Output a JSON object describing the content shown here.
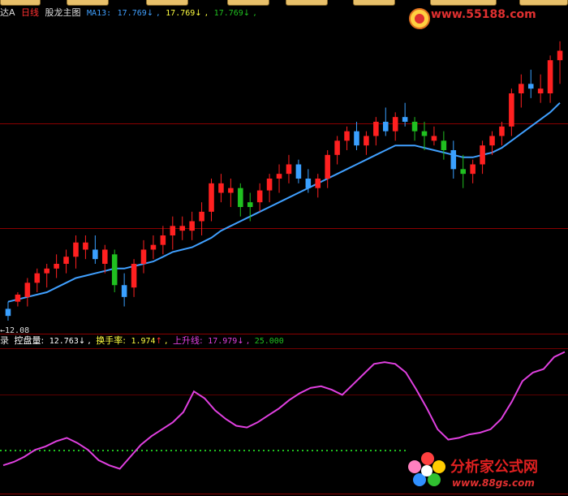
{
  "main_header": {
    "stock_suffix": "达A",
    "period": "日线",
    "indicator_name": "股龙主图",
    "ma_label": "MA13:",
    "ma_value": "17.769",
    "ma_arrow": "↓",
    "val2": "17.769",
    "val2_arrow": "↓",
    "val3": "17.769",
    "val3_arrow": "↓"
  },
  "logo": {
    "site": "www.55188.com"
  },
  "axis": {
    "date_marker": "←12.08"
  },
  "sub_header": {
    "prefix": "录",
    "kp_label": "控盘量:",
    "kp_value": "12.763",
    "kp_arrow": "↓",
    "hs_label": "换手率:",
    "hs_value": "1.974",
    "hs_arrow": "↑",
    "up_label": "上升线:",
    "up_value": "17.979",
    "up_arrow": "↓",
    "level": "25.000"
  },
  "watermark": {
    "title": "分析家公式网",
    "url": "www.88gs.com"
  },
  "colors": {
    "up": "#ff2020",
    "down": "#3aa0ff",
    "green": "#20c020",
    "ma_line": "#40a0ff",
    "ma_hi": "#ffff40",
    "indicator": "#e040e0",
    "dotted": "#20c020"
  },
  "chart_data": {
    "type": "candlestick+line",
    "candles": [
      {
        "o": 5,
        "h": 8,
        "l": 0,
        "c": 2,
        "col": "blue"
      },
      {
        "o": 8,
        "h": 12,
        "l": 6,
        "c": 11,
        "col": "red"
      },
      {
        "o": 10,
        "h": 18,
        "l": 6,
        "c": 16,
        "col": "red"
      },
      {
        "o": 16,
        "h": 22,
        "l": 12,
        "c": 20,
        "col": "red"
      },
      {
        "o": 20,
        "h": 24,
        "l": 14,
        "c": 22,
        "col": "red"
      },
      {
        "o": 22,
        "h": 28,
        "l": 18,
        "c": 24,
        "col": "red"
      },
      {
        "o": 24,
        "h": 30,
        "l": 20,
        "c": 27,
        "col": "red"
      },
      {
        "o": 27,
        "h": 36,
        "l": 22,
        "c": 33,
        "col": "red"
      },
      {
        "o": 33,
        "h": 36,
        "l": 26,
        "c": 30,
        "col": "red"
      },
      {
        "o": 30,
        "h": 36,
        "l": 24,
        "c": 26,
        "col": "blue"
      },
      {
        "o": 24,
        "h": 32,
        "l": 20,
        "c": 30,
        "col": "red"
      },
      {
        "o": 28,
        "h": 30,
        "l": 12,
        "c": 15,
        "col": "green"
      },
      {
        "o": 15,
        "h": 20,
        "l": 6,
        "c": 10,
        "col": "blue"
      },
      {
        "o": 14,
        "h": 26,
        "l": 10,
        "c": 24,
        "col": "red"
      },
      {
        "o": 24,
        "h": 34,
        "l": 20,
        "c": 30,
        "col": "red"
      },
      {
        "o": 30,
        "h": 36,
        "l": 26,
        "c": 32,
        "col": "red"
      },
      {
        "o": 32,
        "h": 40,
        "l": 28,
        "c": 36,
        "col": "red"
      },
      {
        "o": 36,
        "h": 44,
        "l": 30,
        "c": 40,
        "col": "red"
      },
      {
        "o": 40,
        "h": 44,
        "l": 34,
        "c": 38,
        "col": "red"
      },
      {
        "o": 38,
        "h": 46,
        "l": 34,
        "c": 42,
        "col": "red"
      },
      {
        "o": 42,
        "h": 50,
        "l": 36,
        "c": 46,
        "col": "red"
      },
      {
        "o": 46,
        "h": 60,
        "l": 42,
        "c": 58,
        "col": "red"
      },
      {
        "o": 58,
        "h": 62,
        "l": 50,
        "c": 54,
        "col": "red"
      },
      {
        "o": 54,
        "h": 60,
        "l": 48,
        "c": 56,
        "col": "red"
      },
      {
        "o": 56,
        "h": 58,
        "l": 44,
        "c": 48,
        "col": "green"
      },
      {
        "o": 48,
        "h": 54,
        "l": 42,
        "c": 50,
        "col": "green"
      },
      {
        "o": 50,
        "h": 58,
        "l": 46,
        "c": 55,
        "col": "red"
      },
      {
        "o": 55,
        "h": 62,
        "l": 50,
        "c": 60,
        "col": "red"
      },
      {
        "o": 60,
        "h": 66,
        "l": 54,
        "c": 62,
        "col": "red"
      },
      {
        "o": 62,
        "h": 70,
        "l": 58,
        "c": 66,
        "col": "red"
      },
      {
        "o": 66,
        "h": 68,
        "l": 58,
        "c": 60,
        "col": "blue"
      },
      {
        "o": 60,
        "h": 64,
        "l": 54,
        "c": 56,
        "col": "blue"
      },
      {
        "o": 56,
        "h": 62,
        "l": 52,
        "c": 60,
        "col": "red"
      },
      {
        "o": 60,
        "h": 72,
        "l": 56,
        "c": 70,
        "col": "red"
      },
      {
        "o": 70,
        "h": 78,
        "l": 66,
        "c": 76,
        "col": "red"
      },
      {
        "o": 76,
        "h": 82,
        "l": 72,
        "c": 80,
        "col": "red"
      },
      {
        "o": 80,
        "h": 84,
        "l": 72,
        "c": 74,
        "col": "blue"
      },
      {
        "o": 74,
        "h": 80,
        "l": 70,
        "c": 78,
        "col": "red"
      },
      {
        "o": 78,
        "h": 86,
        "l": 74,
        "c": 84,
        "col": "red"
      },
      {
        "o": 84,
        "h": 90,
        "l": 78,
        "c": 80,
        "col": "blue"
      },
      {
        "o": 80,
        "h": 88,
        "l": 76,
        "c": 86,
        "col": "red"
      },
      {
        "o": 86,
        "h": 92,
        "l": 82,
        "c": 84,
        "col": "blue"
      },
      {
        "o": 84,
        "h": 86,
        "l": 76,
        "c": 80,
        "col": "green"
      },
      {
        "o": 80,
        "h": 84,
        "l": 72,
        "c": 78,
        "col": "green"
      },
      {
        "o": 78,
        "h": 82,
        "l": 74,
        "c": 76,
        "col": "red"
      },
      {
        "o": 76,
        "h": 80,
        "l": 68,
        "c": 72,
        "col": "green"
      },
      {
        "o": 72,
        "h": 76,
        "l": 60,
        "c": 64,
        "col": "blue"
      },
      {
        "o": 64,
        "h": 70,
        "l": 56,
        "c": 62,
        "col": "green"
      },
      {
        "o": 62,
        "h": 68,
        "l": 58,
        "c": 66,
        "col": "red"
      },
      {
        "o": 66,
        "h": 76,
        "l": 62,
        "c": 74,
        "col": "red"
      },
      {
        "o": 74,
        "h": 80,
        "l": 70,
        "c": 78,
        "col": "red"
      },
      {
        "o": 78,
        "h": 84,
        "l": 74,
        "c": 82,
        "col": "red"
      },
      {
        "o": 82,
        "h": 98,
        "l": 78,
        "c": 96,
        "col": "red"
      },
      {
        "o": 96,
        "h": 104,
        "l": 90,
        "c": 100,
        "col": "red"
      },
      {
        "o": 100,
        "h": 106,
        "l": 94,
        "c": 98,
        "col": "blue"
      },
      {
        "o": 98,
        "h": 104,
        "l": 92,
        "c": 96,
        "col": "red"
      },
      {
        "o": 96,
        "h": 112,
        "l": 92,
        "c": 110,
        "col": "red"
      },
      {
        "o": 110,
        "h": 118,
        "l": 100,
        "c": 114,
        "col": "red"
      }
    ],
    "ma": [
      8,
      9,
      10,
      11,
      12,
      14,
      16,
      18,
      19,
      20,
      21,
      22,
      22,
      23,
      24,
      25,
      27,
      29,
      30,
      31,
      33,
      35,
      38,
      40,
      42,
      44,
      46,
      48,
      50,
      52,
      54,
      56,
      58,
      60,
      62,
      64,
      66,
      68,
      70,
      72,
      74,
      74,
      74,
      73,
      72,
      71,
      70,
      69,
      69,
      70,
      71,
      73,
      76,
      79,
      82,
      85,
      88,
      92
    ],
    "indicator": [
      30,
      34,
      40,
      48,
      52,
      58,
      62,
      56,
      48,
      36,
      30,
      26,
      40,
      54,
      64,
      72,
      80,
      92,
      116,
      108,
      94,
      84,
      76,
      74,
      80,
      88,
      96,
      106,
      114,
      120,
      122,
      118,
      112,
      124,
      136,
      148,
      150,
      148,
      138,
      118,
      96,
      72,
      60,
      62,
      66,
      68,
      72,
      84,
      104,
      128,
      138,
      142,
      156,
      162
    ]
  }
}
